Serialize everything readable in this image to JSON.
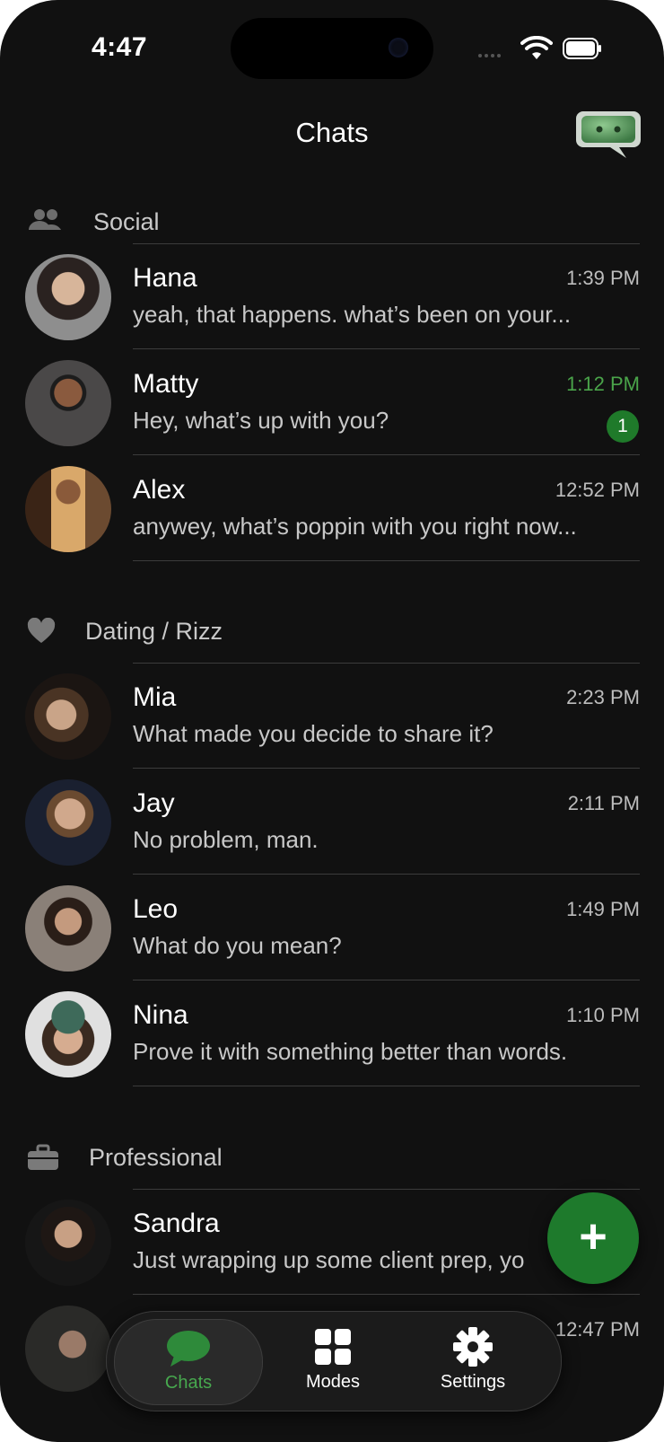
{
  "status_bar": {
    "time": "4:47"
  },
  "header": {
    "title": "Chats"
  },
  "colors": {
    "accent": "#1e7a2c",
    "accent_text": "#4aa44a",
    "background": "#111111"
  },
  "sections": [
    {
      "label": "Social",
      "icon": "people-icon",
      "chats": [
        {
          "name": "Hana",
          "time": "1:39 PM",
          "message": "yeah, that happens. what’s been on your...",
          "unread": 0
        },
        {
          "name": "Matty",
          "time": "1:12 PM",
          "message": "Hey, what’s up with you?",
          "unread": 1,
          "unread_label": "1"
        },
        {
          "name": "Alex",
          "time": "12:52 PM",
          "message": "anywey, what’s poppin with you right now...",
          "unread": 0
        }
      ]
    },
    {
      "label": "Dating / Rizz",
      "icon": "heart-icon",
      "chats": [
        {
          "name": "Mia",
          "time": "2:23 PM",
          "message": "What made you decide to share it?",
          "unread": 0
        },
        {
          "name": "Jay",
          "time": "2:11 PM",
          "message": "No problem, man.",
          "unread": 0
        },
        {
          "name": "Leo",
          "time": "1:49 PM",
          "message": "What do you mean?",
          "unread": 0
        },
        {
          "name": "Nina",
          "time": "1:10 PM",
          "message": "Prove it with something better than words.",
          "unread": 0
        }
      ]
    },
    {
      "label": "Professional",
      "icon": "briefcase-icon",
      "chats": [
        {
          "name": "Sandra",
          "time": "",
          "message": "Just wrapping up some client prep, yo",
          "unread": 0
        },
        {
          "name": "",
          "time": "12:47 PM",
          "message": "",
          "unread": 0
        }
      ]
    }
  ],
  "fab": {
    "label": "+"
  },
  "tabbar": {
    "tabs": [
      {
        "label": "Chats",
        "icon": "chat-bubble-icon",
        "active": true
      },
      {
        "label": "Modes",
        "icon": "grid-icon",
        "active": false
      },
      {
        "label": "Settings",
        "icon": "gear-icon",
        "active": false
      }
    ]
  }
}
